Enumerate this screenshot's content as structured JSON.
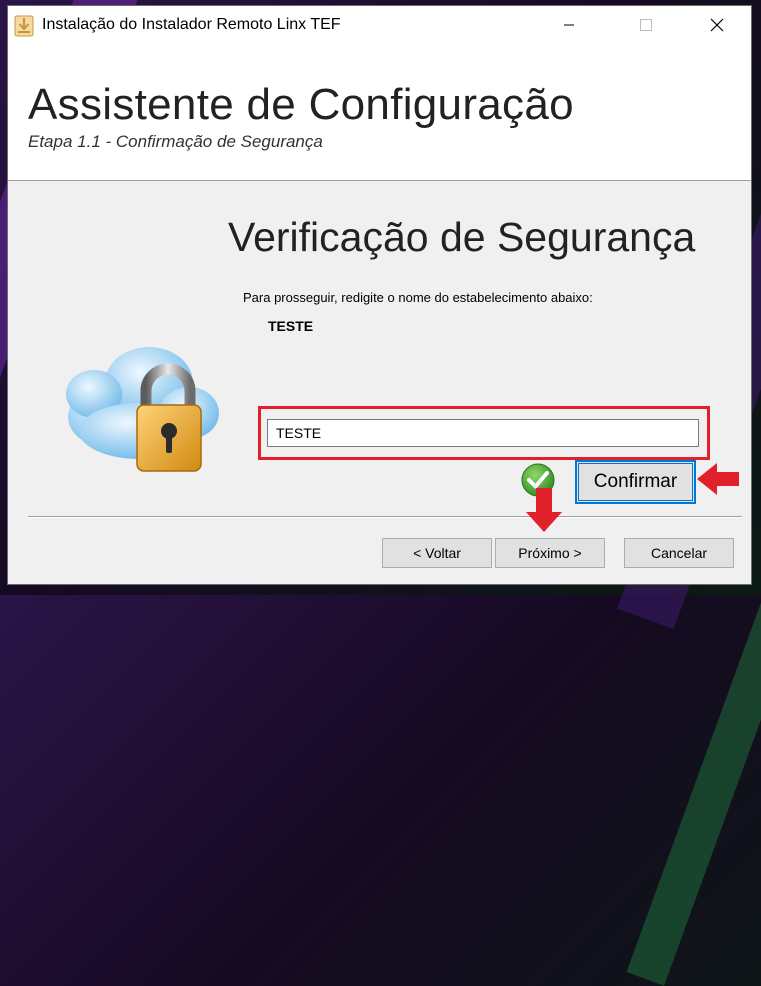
{
  "window": {
    "title": "Instalação do Instalador Remoto Linx TEF",
    "icon": "installer-icon"
  },
  "header": {
    "title": "Assistente de Configuração",
    "subtitle": "Etapa 1.1 - Confirmação de Segurança"
  },
  "main": {
    "heading": "Verificação de Segurança",
    "instruction": "Para prosseguir, redigite o nome do estabelecimento abaixo:",
    "establishment_name": "TESTE",
    "input_value": "TESTE",
    "illustration": "cloud-padlock-icon",
    "status_icon": "green-check-icon",
    "confirm_label": "Confirmar"
  },
  "footer": {
    "back_label": "< Voltar",
    "next_label": "Próximo >",
    "cancel_label": "Cancelar"
  },
  "colors": {
    "highlight": "#e0202a",
    "focus": "#0078d7",
    "check": "#3a9a2a"
  }
}
